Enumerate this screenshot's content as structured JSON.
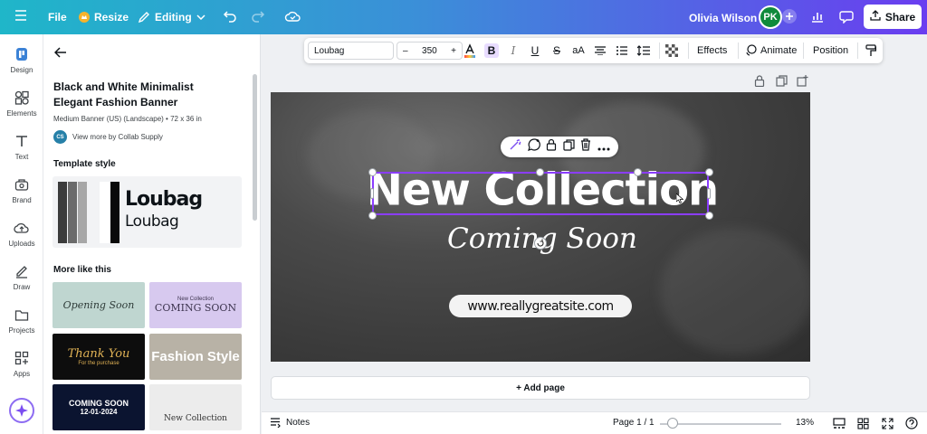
{
  "topbar": {
    "menu_label": "",
    "file": "File",
    "resize": "Resize",
    "editing": "Editing",
    "user_name": "Olivia Wilson",
    "avatar_initials": "PK",
    "share": "Share"
  },
  "sidebar": {
    "items": [
      {
        "label": "Design",
        "icon": "design-icon"
      },
      {
        "label": "Elements",
        "icon": "elements-icon"
      },
      {
        "label": "Text",
        "icon": "text-icon"
      },
      {
        "label": "Brand",
        "icon": "brand-icon"
      },
      {
        "label": "Uploads",
        "icon": "uploads-icon"
      },
      {
        "label": "Draw",
        "icon": "draw-icon"
      },
      {
        "label": "Projects",
        "icon": "projects-icon"
      },
      {
        "label": "Apps",
        "icon": "apps-icon"
      }
    ]
  },
  "panel": {
    "title": "Black and White Minimalist Elegant Fashion Banner",
    "subtitle": "Medium Banner (US) (Landscape) • 72 x 36 in",
    "author_initials": "CS",
    "author_link": "View more by Collab Supply",
    "template_style_heading": "Template style",
    "font_preview_bold": "Loubag",
    "font_preview_regular": "Loubag",
    "more_heading": "More like this",
    "thumbnails": [
      {
        "title": "Opening Soon",
        "sub": "",
        "bg": "#bfd6d0",
        "fg": "#2e3b38"
      },
      {
        "title": "New Collection",
        "sub": "COMING SOON",
        "bg": "#d7c9ef",
        "fg": "#3e3550"
      },
      {
        "title": "Thank You",
        "sub": "For the purchase",
        "bg": "#0d0d0d",
        "fg": "#e0b255"
      },
      {
        "title": "Fashion Style",
        "sub": "",
        "bg": "#b8b2a6",
        "fg": "#ffffff"
      },
      {
        "title": "COMING SOON",
        "sub": "12-01-2024",
        "bg": "#0b1430",
        "fg": "#ffffff"
      },
      {
        "title": "New Collection",
        "sub": "",
        "bg": "#ececec",
        "fg": "#333333"
      }
    ]
  },
  "toolbar": {
    "font": "Loubag",
    "minus": "–",
    "size": "350",
    "plus": "+",
    "effects": "Effects",
    "animate": "Animate",
    "position": "Position"
  },
  "canvas": {
    "headline": "New Collection",
    "subline": "Coming Soon",
    "url": "www.reallygreatsite.com"
  },
  "add_page": "+ Add page",
  "bottombar": {
    "notes": "Notes",
    "page": "Page 1 / 1",
    "zoom": "13%"
  },
  "colors": {
    "accent": "#8b3dff",
    "gradient_start": "#1fb6c9",
    "gradient_end": "#6a3df0"
  }
}
